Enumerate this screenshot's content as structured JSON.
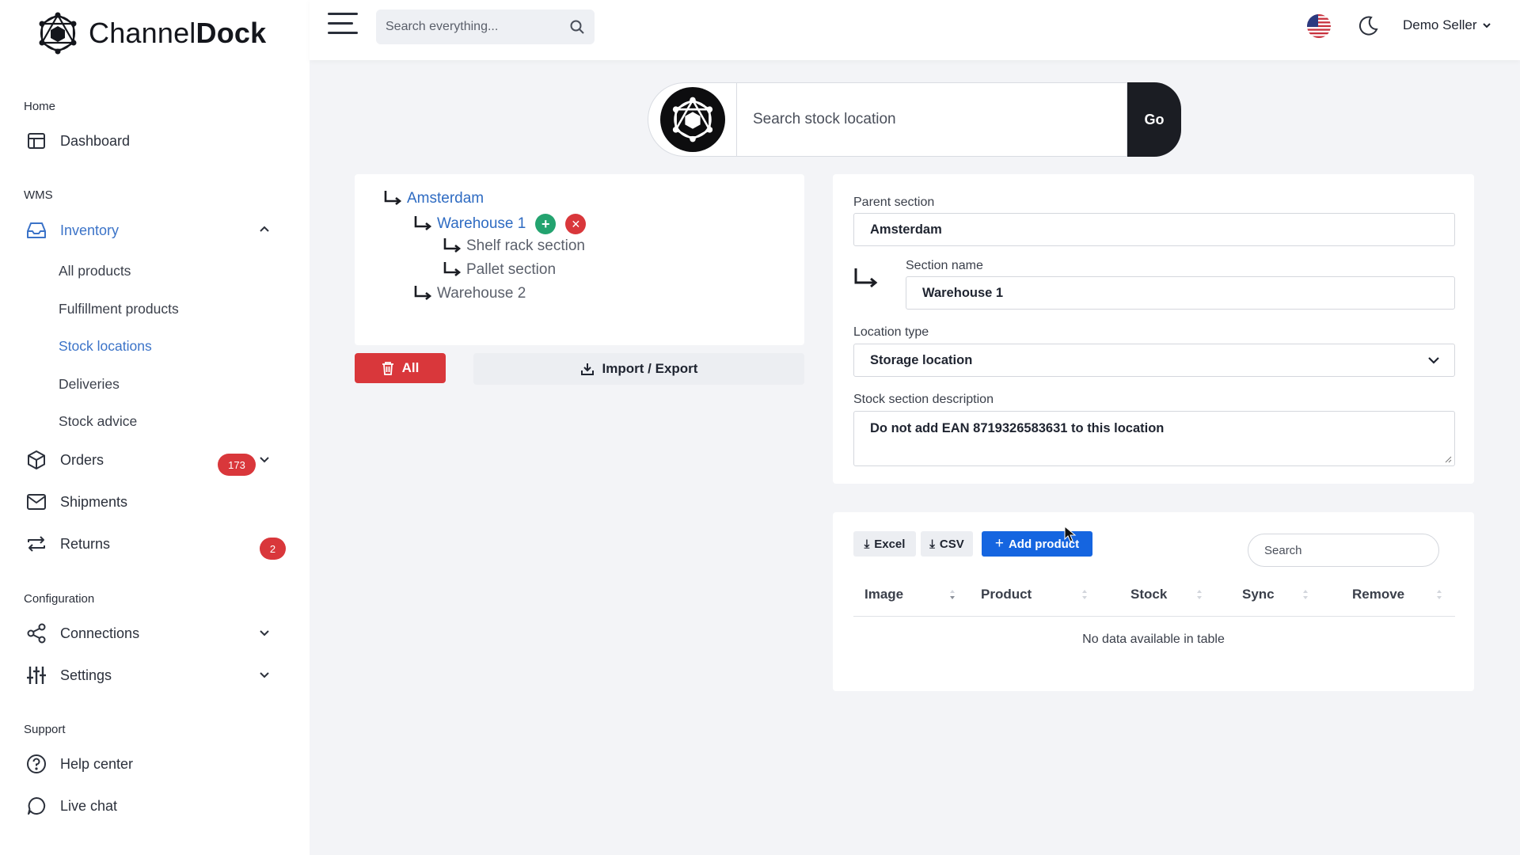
{
  "app": {
    "brand_light": "Channel",
    "brand_bold": "Dock"
  },
  "topbar": {
    "search_placeholder": "Search everything...",
    "user_name": "Demo Seller"
  },
  "sidebar": {
    "section_home": "Home",
    "dashboard": "Dashboard",
    "section_wms": "WMS",
    "inventory": "Inventory",
    "inventory_sub": [
      "All products",
      "Fulfillment products",
      "Stock locations",
      "Deliveries",
      "Stock advice"
    ],
    "orders": "Orders",
    "orders_badge": "173",
    "shipments": "Shipments",
    "returns": "Returns",
    "returns_badge": "2",
    "section_config": "Configuration",
    "connections": "Connections",
    "settings": "Settings",
    "section_support": "Support",
    "help": "Help center",
    "chat": "Live chat"
  },
  "location_search": {
    "placeholder": "Search stock location",
    "go": "Go"
  },
  "tree": {
    "root": "Amsterdam",
    "warehouse1": "Warehouse 1",
    "shelf": "Shelf rack section",
    "pallet": "Pallet section",
    "warehouse2": "Warehouse 2"
  },
  "tree_actions": {
    "all": "All",
    "import_export": "Import / Export"
  },
  "form": {
    "parent_label": "Parent section",
    "parent_value": "Amsterdam",
    "section_label": "Section name",
    "section_value": "Warehouse 1",
    "type_label": "Location type",
    "type_value": "Storage location",
    "desc_label": "Stock section description",
    "desc_value": "Do not add EAN 8719326583631 to this location"
  },
  "table": {
    "excel": "Excel",
    "csv": "CSV",
    "add_product": "Add product",
    "search_placeholder": "Search",
    "headers": [
      "Image",
      "Product",
      "Stock",
      "Sync",
      "Remove"
    ],
    "empty": "No data available in table"
  },
  "colors": {
    "accent": "#3b73c8",
    "danger": "#d9373b",
    "primary": "#1565e0",
    "success": "#23a36f"
  }
}
